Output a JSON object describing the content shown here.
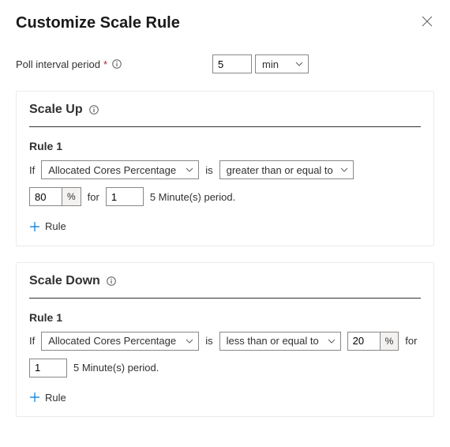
{
  "header": {
    "title": "Customize Scale Rule"
  },
  "poll": {
    "label": "Poll interval period",
    "required": "*",
    "value": "5",
    "unit": "min"
  },
  "text": {
    "if": "If",
    "is": "is",
    "for": "for",
    "periodSuffix": "5 Minute(s) period.",
    "addRule": "Rule",
    "pct": "%"
  },
  "scaleUp": {
    "title": "Scale Up",
    "rules": [
      {
        "label": "Rule 1",
        "metric": "Allocated Cores Percentage",
        "operator": "greater than or equal to",
        "threshold": "80",
        "periods": "1"
      }
    ]
  },
  "scaleDown": {
    "title": "Scale Down",
    "rules": [
      {
        "label": "Rule 1",
        "metric": "Allocated Cores Percentage",
        "operator": "less than or equal to",
        "threshold": "20",
        "periods": "1"
      }
    ]
  }
}
